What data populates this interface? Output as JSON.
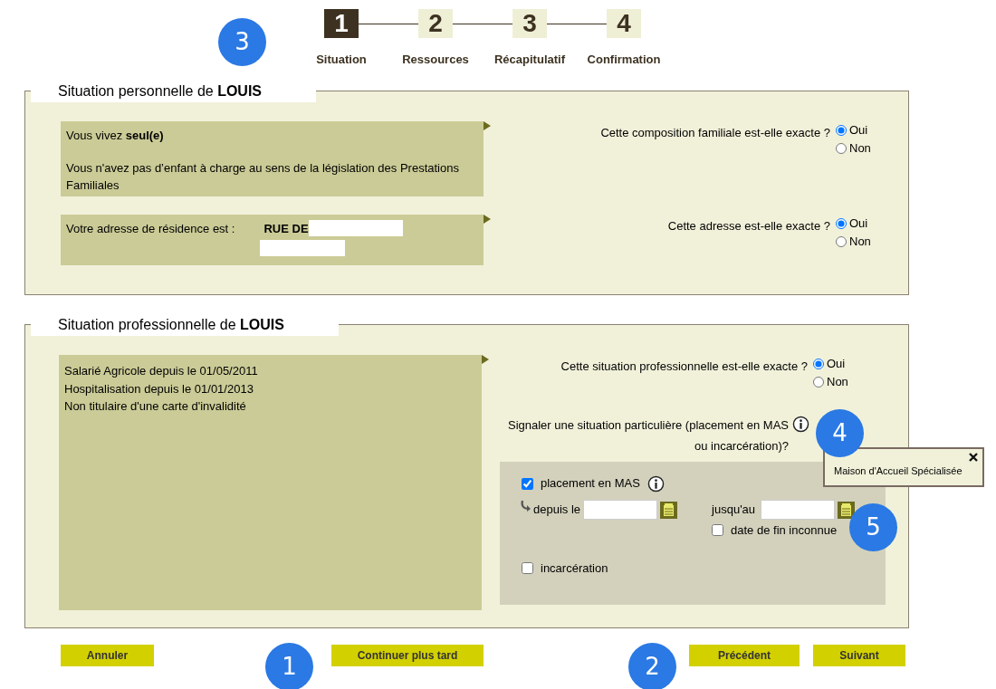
{
  "steps": [
    {
      "number": "1",
      "label": "Situation",
      "selected": true
    },
    {
      "number": "2",
      "label": "Ressources",
      "selected": false
    },
    {
      "number": "3",
      "label": "Récapitulatif",
      "selected": false
    },
    {
      "number": "4",
      "label": "Confirmation",
      "selected": false
    }
  ],
  "personal": {
    "title": "Situation personnelle de **LOUIS**",
    "family": {
      "lines": [
        "Vous vivez **seul(e)**",
        "Vous n'avez pas d’enfant à charge au sens de la législation des Prestations Familiales"
      ],
      "question": "Cette composition familiale est-elle exacte ?",
      "options": [
        {
          "label": "Oui",
          "selected": true
        },
        {
          "label": "Non",
          "selected": false
        }
      ]
    },
    "address": {
      "label": "Votre adresse de résidence est :",
      "street": "RUE DE",
      "question": "Cette adresse est-elle exacte ?",
      "options": [
        {
          "label": "Oui",
          "selected": true
        },
        {
          "label": "Non",
          "selected": false
        }
      ]
    }
  },
  "professional": {
    "title": "Situation professionnelle de **LOUIS**",
    "lines": [
      "Salarié Agricole depuis le 01/05/2011",
      "Hospitalisation depuis le 01/01/2013",
      "Non titulaire d'une carte d'invalidité"
    ],
    "question": "Cette situation professionnelle est-elle exacte ?",
    "options": [
      {
        "label": "Oui",
        "selected": true
      },
      {
        "label": "Non",
        "selected": false
      }
    ],
    "special_prompt": "Signaler une situation particulière (placement en MAS ou incarcération)?",
    "tooltip": {
      "text": "Maison d'Accueil Spécialisée"
    },
    "placement": {
      "label": "placement en MAS",
      "checked": true,
      "from_label": "depuis le",
      "to_label": "jusqu'au",
      "unknown_end": {
        "label": "date de fin inconnue",
        "checked": false
      }
    },
    "incarceration": {
      "label": "incarcération",
      "checked": false
    }
  },
  "buttons": [
    {
      "label": "Annuler",
      "kind": "left"
    },
    {
      "label": "Continuer plus tard",
      "kind": "left"
    },
    {
      "label": "Précédent",
      "kind": "right"
    },
    {
      "label": "Suivant",
      "kind": "right"
    }
  ],
  "callouts": [
    "1",
    "2",
    "3",
    "4",
    "5"
  ]
}
